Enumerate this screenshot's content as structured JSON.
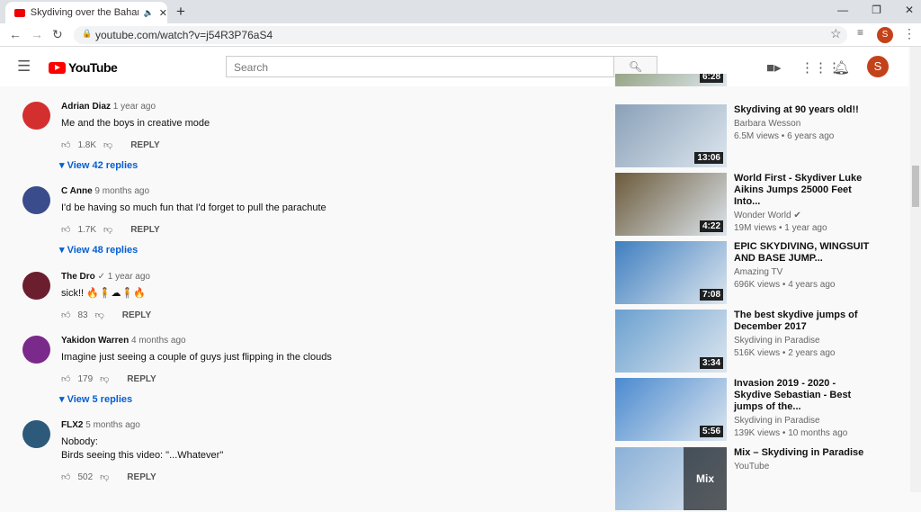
{
  "browser": {
    "tab_title": "Skydiving over the Bahamas",
    "url": "youtube.com/watch?v=j54R3P76aS4",
    "profile_initial": "S"
  },
  "header": {
    "logo": "YouTube",
    "search_placeholder": "Search",
    "profile_initial": "S"
  },
  "comments": [
    {
      "author": "Adrian Diaz",
      "time": "1 year ago",
      "text": [
        "Me and the boys in creative mode"
      ],
      "likes": "1.8K",
      "reply": "REPLY",
      "replies": "View 42 replies",
      "avatar_color": "#d32f2f"
    },
    {
      "author": "C Anne",
      "time": "9 months ago",
      "text": [
        "I'd be having so much fun that I'd forget to pull the parachute"
      ],
      "likes": "1.7K",
      "reply": "REPLY",
      "replies": "View 48 replies",
      "avatar_color": "#3a4c8c"
    },
    {
      "author": "The Dro",
      "time": "1 year ago",
      "text": [
        "sick!! 🔥🧍☁🧍🔥"
      ],
      "likes": "83",
      "reply": "REPLY",
      "replies": "",
      "avatar_color": "#6b1e2e"
    },
    {
      "author": "Yakidon Warren",
      "time": "4 months ago",
      "text": [
        "Imagine just seeing a couple of guys just flipping in the clouds"
      ],
      "likes": "179",
      "reply": "REPLY",
      "replies": "View 5 replies",
      "avatar_color": "#7a2a8a"
    },
    {
      "author": "FLX2",
      "time": "5 months ago",
      "text": [
        "Nobody:",
        "Birds seeing this video: \"...Whatever\""
      ],
      "likes": "502",
      "reply": "REPLY",
      "replies": "",
      "avatar_color": "#2d5a7a"
    }
  ],
  "videos": [
    {
      "title": "",
      "channel": "",
      "meta": "",
      "duration": "6:28",
      "color": "#7a8a5a"
    },
    {
      "title": "Skydiving at 90 years old!!",
      "channel": "Barbara Wesson",
      "meta": "6.5M views • 6 years ago",
      "duration": "13:06",
      "color": "#8aa0b8"
    },
    {
      "title": "World First - Skydiver Luke Aikins Jumps 25000 Feet Into...",
      "channel": "Wonder World",
      "meta": "19M views • 1 year ago",
      "duration": "4:22",
      "color": "#6b5a3a",
      "verified": true
    },
    {
      "title": "EPIC SKYDIVING, WINGSUIT AND BASE JUMP...",
      "channel": "Amazing TV",
      "meta": "696K views • 4 years ago",
      "duration": "7:08",
      "color": "#3f7fc0"
    },
    {
      "title": "The best skydive jumps of December 2017",
      "channel": "Skydiving in Paradise",
      "meta": "516K views • 2 years ago",
      "duration": "3:34",
      "color": "#6aa0d0"
    },
    {
      "title": "Invasion 2019 - 2020 - Skydive Sebastian - Best jumps of the...",
      "channel": "Skydiving in Paradise",
      "meta": "139K views • 10 months ago",
      "duration": "5:56",
      "color": "#4a8ad0"
    },
    {
      "title": "Mix – Skydiving in Paradise",
      "channel": "YouTube",
      "meta": "",
      "duration": "Mix",
      "color": "#8ab0d8"
    }
  ]
}
